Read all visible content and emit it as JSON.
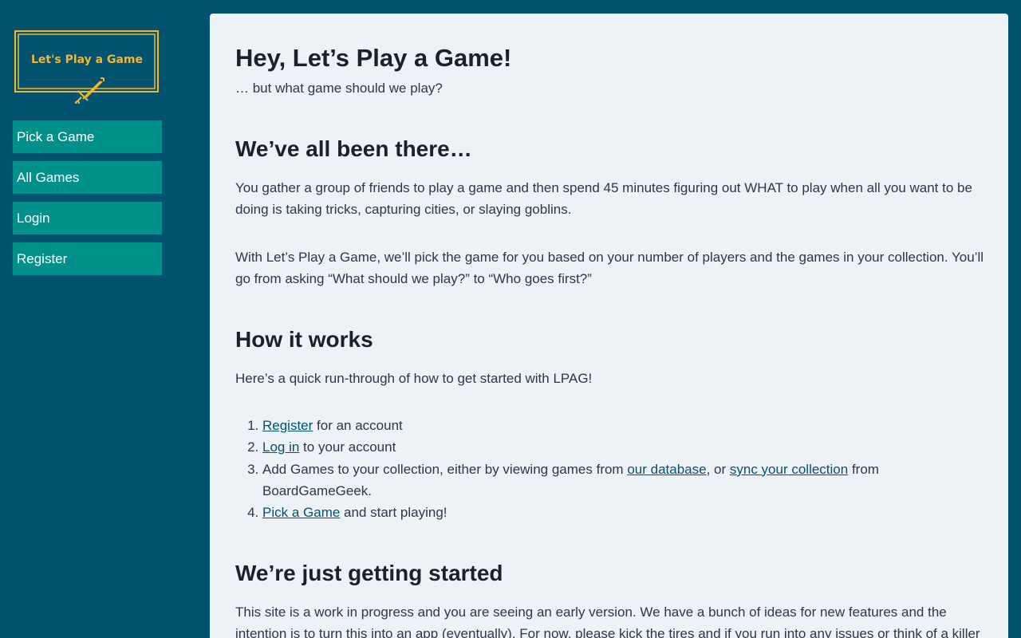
{
  "logo": {
    "text": "Let's Play a Game",
    "colors": {
      "gold": "#f2b632",
      "background": "#035270"
    },
    "icon": "sword-icon"
  },
  "nav": {
    "items": [
      {
        "label": "Pick a Game"
      },
      {
        "label": "All Games"
      },
      {
        "label": "Login"
      },
      {
        "label": "Register"
      }
    ]
  },
  "main": {
    "title": "Hey, Let’s Play a Game!",
    "subtitle": "… but what game should we play?",
    "section1": {
      "heading": "We’ve all been there…",
      "p1": "You gather a group of friends to play a game and then spend 45 minutes figuring out WHAT to play when all you want to be doing is taking tricks, capturing cities, or slaying goblins.",
      "p2": "With Let’s Play a Game, we’ll pick the game for you based on your number of players and the games in your collection. You’ll go from asking “What should we play?” to “Who goes first?”"
    },
    "section2": {
      "heading": "How it works",
      "intro": "Here’s a quick run-through of how to get started with LPAG!",
      "steps": {
        "s1_link": "Register",
        "s1_text": " for an account",
        "s2_link": "Log in",
        "s2_text": " to your account",
        "s3_text_a": "Add Games to your collection, either by viewing games from ",
        "s3_link_a": "our database",
        "s3_text_b": ", or ",
        "s3_link_b": "sync your collection",
        "s3_text_c": " from BoardGameGeek.",
        "s4_link": "Pick a Game",
        "s4_text": " and start playing!"
      }
    },
    "section3": {
      "heading": "We’re just getting started",
      "p1": "This site is a work in progress and you are seeing an early version. We have a bunch of ideas for new features and the intention is to turn this into an app (eventually). For now, please kick the tires and if you run into any issues or think of a killer"
    }
  },
  "colors": {
    "page_bg": "#035270",
    "nav_bg": "#02918a",
    "content_bg": "#edf2f7",
    "link": "#035270"
  }
}
